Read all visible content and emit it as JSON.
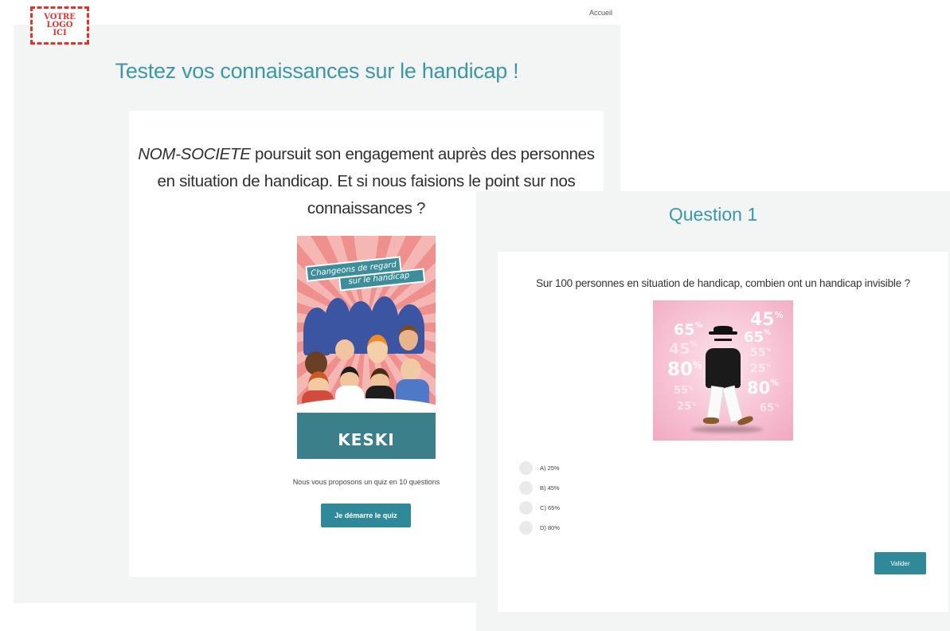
{
  "logo": {
    "lines": [
      "VOTRE",
      "LOGO",
      "ICI"
    ]
  },
  "nav": {
    "home": "Accueil"
  },
  "intro_screen": {
    "title": "Testez vos connaissances sur le handicap !",
    "company": "NOM-SOCIETE",
    "intro_line1_rest": " poursuit son engagement auprès des personnes",
    "intro_line2": "en situation de handicap. Et si nous faisions le point sur nos",
    "intro_line3": "connaissances ?",
    "poster": {
      "banner_line1": "Changeons de regard",
      "banner_line2": "sur le handicap",
      "brand": "KESKI"
    },
    "propose_text": "Nous vous proposons un quiz en 10 questions",
    "start_button": "Je démarre le quiz"
  },
  "question_screen": {
    "title": "Question 1",
    "question": "Sur 100 personnes en situation de handicap, combien ont un handicap invisible ?",
    "image_numbers": [
      "65",
      "45",
      "80",
      "55",
      "25",
      "45",
      "65",
      "55",
      "25",
      "80",
      "65"
    ],
    "options": [
      {
        "label": "A) 25%",
        "selected": false
      },
      {
        "label": "B) 45%",
        "selected": false
      },
      {
        "label": "C) 65%",
        "selected": false
      },
      {
        "label": "D) 80%",
        "selected": false
      }
    ],
    "validate_button": "Valider"
  },
  "colors": {
    "accent": "#2f8998",
    "title": "#3b98a8",
    "logo_red": "#e2342d"
  }
}
